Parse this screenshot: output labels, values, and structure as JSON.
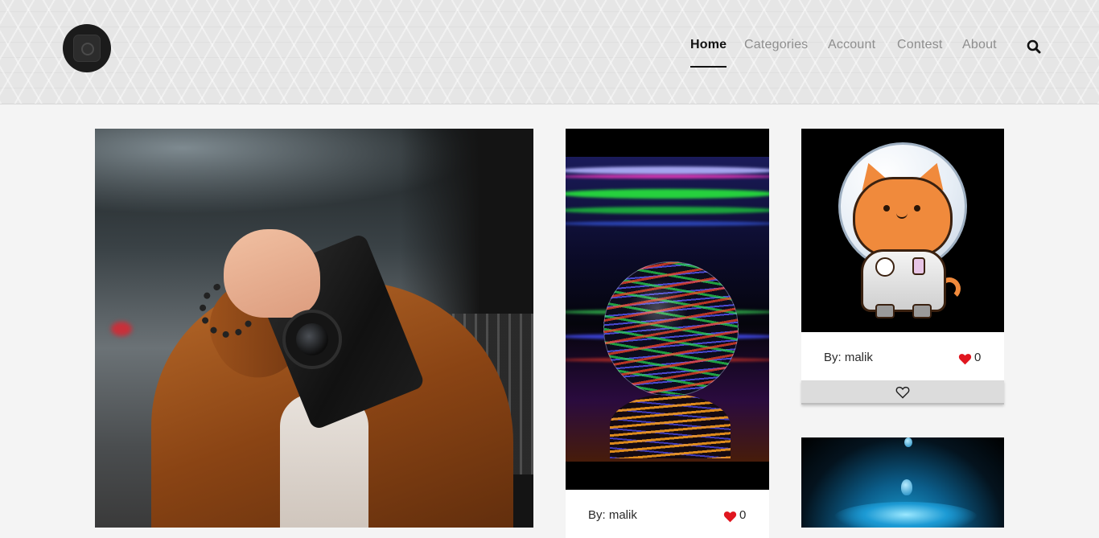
{
  "nav": {
    "items": [
      {
        "label": "Home",
        "active": true
      },
      {
        "label": "Categories",
        "active": false
      },
      {
        "label": "Account",
        "active": false
      },
      {
        "label": "Contest",
        "active": false
      },
      {
        "label": "About",
        "active": false
      }
    ],
    "search_icon": "search-icon",
    "logo_icon": "camera-logo-icon"
  },
  "gallery": {
    "posts": [
      {
        "image": "person holding camera photo"
      },
      {
        "image": "light painting crystal ball photo",
        "author": "By: malik",
        "likes": "0"
      },
      {
        "image": "astronaut cat illustration",
        "author": "By: malik",
        "likes": "0",
        "like_icon": "heart-outline-icon"
      },
      {
        "image": "water splash photo"
      }
    ]
  },
  "colors": {
    "heart": "#e0161f",
    "active_nav": "#111111",
    "inactive_nav": "#8e8e8e"
  }
}
